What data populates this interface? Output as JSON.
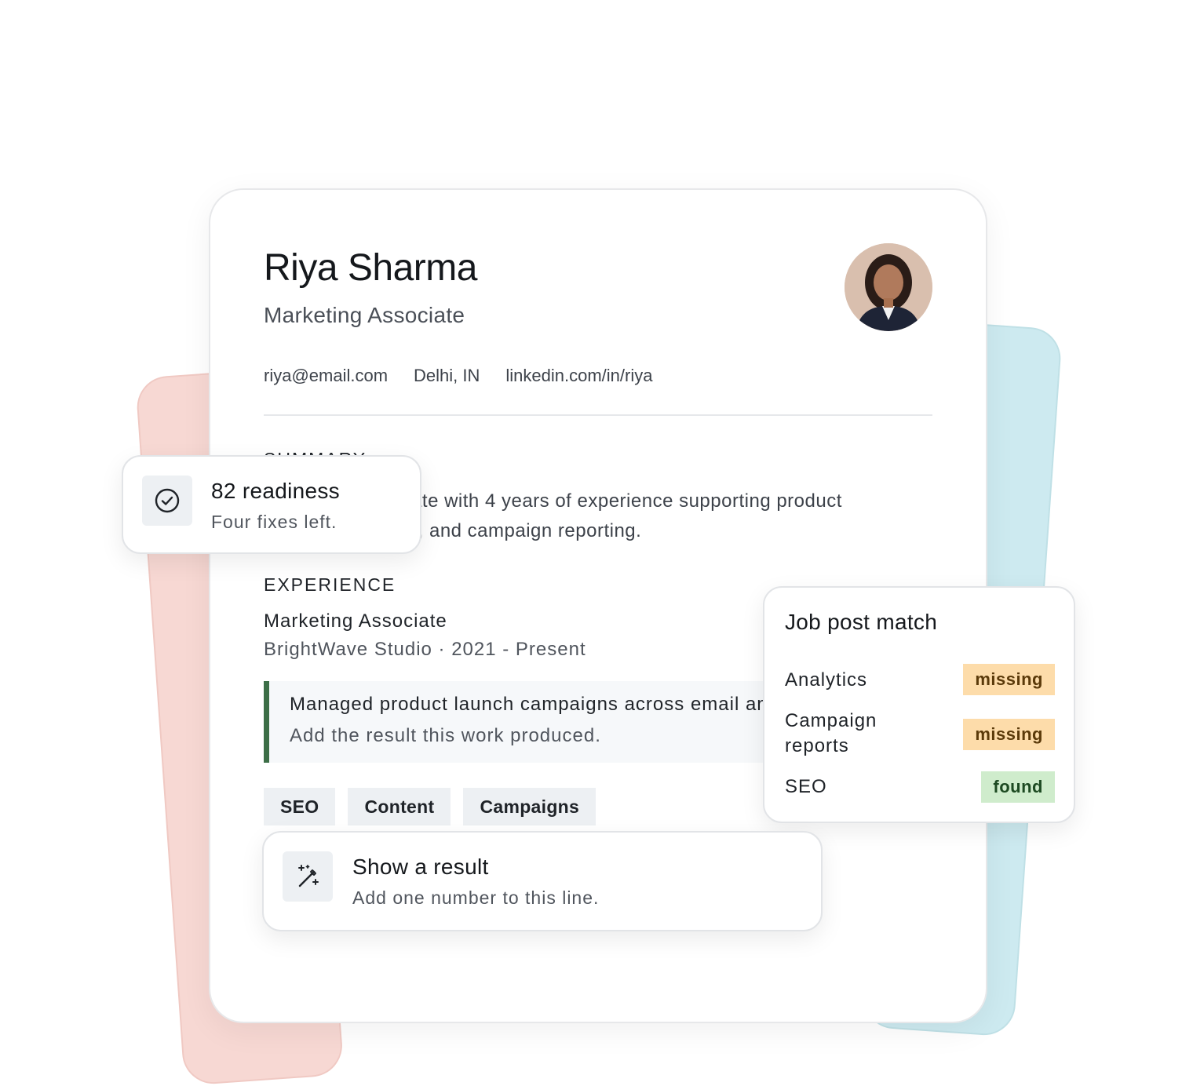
{
  "resume": {
    "name": "Riya Sharma",
    "role": "Marketing Associate",
    "avatar_icon": "person-portrait-icon",
    "contact": {
      "email": "riya@email.com",
      "location": "Delhi, IN",
      "linkedin": "linkedin.com/in/riya"
    },
    "summary": {
      "label": "SUMMARY",
      "text": "Marketing associate with 4 years of experience supporting product launches, content, and campaign reporting."
    },
    "experience": {
      "label": "EXPERIENCE",
      "job_title": "Marketing Associate",
      "job_meta": "BrightWave Studio · 2021 - Present",
      "bullet": "Managed product launch campaigns across email and social channels.",
      "bullet_hint": "Add the result this work produced."
    },
    "tags": [
      "SEO",
      "Content",
      "Campaigns"
    ]
  },
  "readiness": {
    "icon": "check-circle-icon",
    "title": "82 readiness",
    "subtitle": "Four fixes left."
  },
  "job_match": {
    "title": "Job post match",
    "rows": [
      {
        "label": "Analytics",
        "status": "missing"
      },
      {
        "label": "Campaign reports",
        "status": "missing"
      },
      {
        "label": "SEO",
        "status": "found"
      }
    ]
  },
  "suggestion": {
    "icon": "magic-wand-icon",
    "title": "Show a result",
    "subtitle": "Add one number to this line."
  },
  "colors": {
    "accent_bar": "#3c6e47",
    "missing_bg": "#fddcaa",
    "found_bg": "#cfeccc",
    "bg_card_pink": "#f7d8d3",
    "bg_card_teal": "#cdeaf0"
  }
}
